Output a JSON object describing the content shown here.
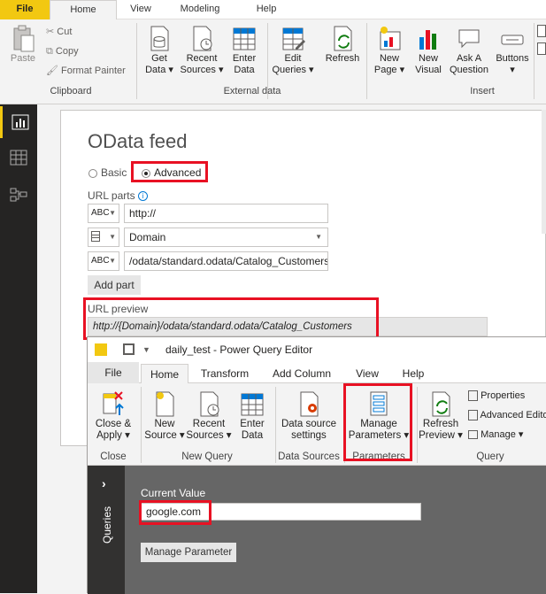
{
  "top_ribbon": {
    "tabs": [
      "File",
      "Home",
      "View",
      "Modeling",
      "Help"
    ],
    "clipboard": {
      "paste": "Paste",
      "cut": "Cut",
      "copy": "Copy",
      "format_painter": "Format Painter",
      "group": "Clipboard"
    },
    "external": {
      "get_data": [
        "Get",
        "Data ▾"
      ],
      "recent_sources": [
        "Recent",
        "Sources ▾"
      ],
      "enter_data": [
        "Enter",
        "Data"
      ],
      "edit_queries": [
        "Edit",
        "Queries ▾"
      ],
      "refresh": "Refresh",
      "group": "External data"
    },
    "insert": {
      "new_page": [
        "New",
        "Page ▾"
      ],
      "new_visual": [
        "New",
        "Visual"
      ],
      "ask_question": [
        "Ask A",
        "Question"
      ],
      "buttons": [
        "Buttons",
        "▾"
      ],
      "group": "Insert"
    },
    "accent": "#f2c811"
  },
  "odata": {
    "title": "OData feed",
    "basic": "Basic",
    "advanced": "Advanced",
    "url_parts": "URL parts",
    "part1_type": "ABC",
    "part1_value": "http://",
    "part2_value": "Domain",
    "part3_type": "ABC",
    "part3_value": "/odata/standard.odata/Catalog_Customers",
    "add_part": "Add part",
    "url_preview_label": "URL preview",
    "url_preview": "http://{Domain}/odata/standard.odata/Catalog_Customers"
  },
  "pqe": {
    "title": "daily_test - Power Query Editor",
    "tabs": [
      "File",
      "Home",
      "Transform",
      "Add Column",
      "View",
      "Help"
    ],
    "close_apply": [
      "Close &",
      "Apply ▾"
    ],
    "close_group": "Close",
    "new_source": [
      "New",
      "Source ▾"
    ],
    "recent_sources": [
      "Recent",
      "Sources ▾"
    ],
    "enter_data": [
      "Enter",
      "Data"
    ],
    "new_query_group": "New Query",
    "data_source_settings": [
      "Data source",
      "settings"
    ],
    "data_sources_group": "Data Sources",
    "manage_parameters": [
      "Manage",
      "Parameters ▾"
    ],
    "parameters_group": "Parameters",
    "refresh_preview": [
      "Refresh",
      "Preview ▾"
    ],
    "properties": "Properties",
    "advanced_editor": "Advanced Editor",
    "manage": "Manage ▾",
    "query_group": "Query",
    "queries_pane": "Queries",
    "current_value_label": "Current Value",
    "current_value": "google.com",
    "manage_parameter_button": "Manage Parameter",
    "highlight_color": "#e81123"
  }
}
